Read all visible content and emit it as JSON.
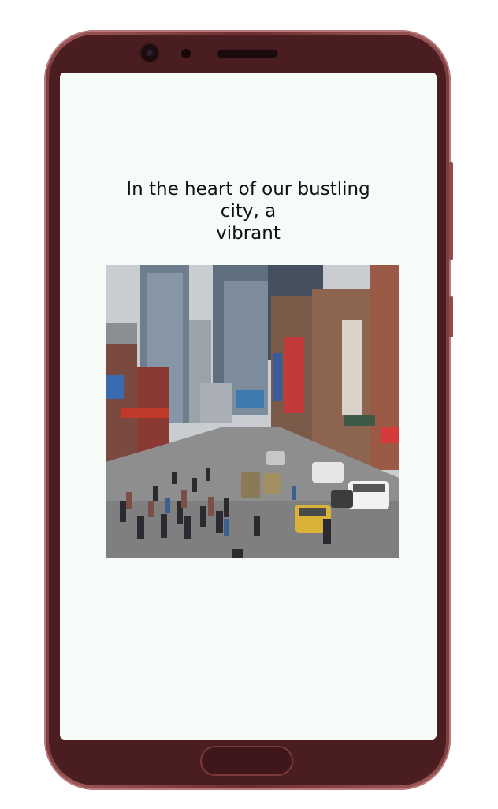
{
  "story": {
    "caption": "In the heart of our bustling\ncity, a\nvibrant"
  },
  "illustration": {
    "subject": "busy city street with skyscrapers, crowds and taxis"
  },
  "colors": {
    "phone_frame": "#7a3a3c",
    "screen_background": "#f7fbf7"
  }
}
